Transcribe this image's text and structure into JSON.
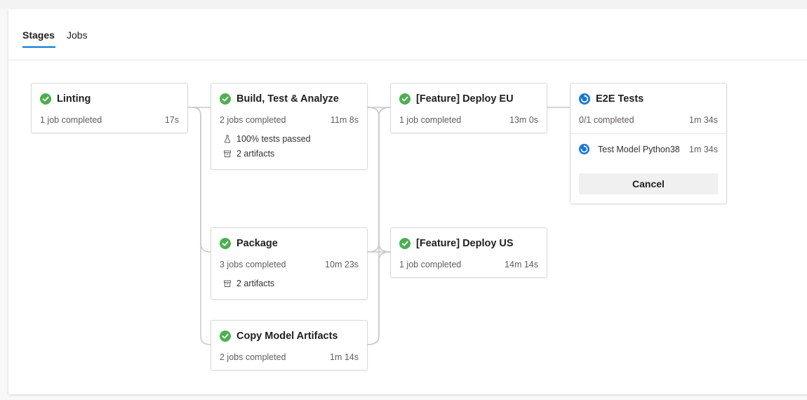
{
  "tabs": [
    {
      "label": "Stages",
      "active": true
    },
    {
      "label": "Jobs",
      "active": false
    }
  ],
  "colors": {
    "success": "#4caf50",
    "running": "#1976d2",
    "tab_underline": "#0078d4",
    "connector": "#c8c8c8"
  },
  "stages": {
    "linting": {
      "title": "Linting",
      "status": "success",
      "jobs": "1 job completed",
      "duration": "17s"
    },
    "build": {
      "title": "Build, Test & Analyze",
      "status": "success",
      "jobs": "2 jobs completed",
      "duration": "11m 8s",
      "tests": "100% tests passed",
      "artifacts": "2 artifacts"
    },
    "package": {
      "title": "Package",
      "status": "success",
      "jobs": "3 jobs completed",
      "duration": "10m 23s",
      "artifacts": "2 artifacts"
    },
    "copy": {
      "title": "Copy Model Artifacts",
      "status": "success",
      "jobs": "2 jobs completed",
      "duration": "1m 14s"
    },
    "deploy_eu": {
      "title": "[Feature] Deploy EU",
      "status": "success",
      "jobs": "1 job completed",
      "duration": "13m 0s"
    },
    "deploy_us": {
      "title": "[Feature] Deploy US",
      "status": "success",
      "jobs": "1 job completed",
      "duration": "14m 14s"
    },
    "e2e": {
      "title": "E2E Tests",
      "status": "running",
      "jobs": "0/1 completed",
      "duration": "1m 34s",
      "job": {
        "name": "Test Model Python38",
        "duration": "1m 34s",
        "status": "running"
      },
      "cancel_label": "Cancel"
    }
  },
  "icons": {
    "success": "check-circle-icon",
    "running": "in-progress-icon",
    "tests": "flask-icon",
    "artifacts": "archive-icon"
  }
}
